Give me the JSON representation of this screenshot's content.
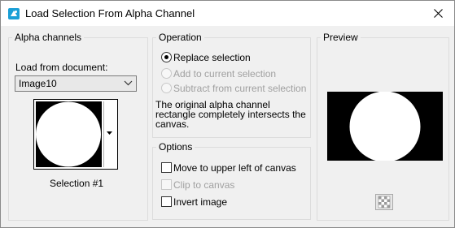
{
  "window": {
    "title": "Load Selection From Alpha Channel",
    "icon": "app-icon",
    "close_icon": "close-icon"
  },
  "alpha_channels": {
    "group_label": "Alpha channels",
    "load_from_label": "Load from document:",
    "document": {
      "selected": "Image10"
    },
    "selection_name": "Selection #1"
  },
  "operation": {
    "group_label": "Operation",
    "options": [
      {
        "label": "Replace selection",
        "checked": true,
        "enabled": true
      },
      {
        "label": "Add to current selection",
        "checked": false,
        "enabled": false
      },
      {
        "label": "Subtract from current selection",
        "checked": false,
        "enabled": false
      }
    ],
    "description": [
      "The original alpha channel",
      "rectangle completely intersects the",
      "canvas."
    ]
  },
  "options": {
    "group_label": "Options",
    "items": [
      {
        "label": "Move to upper left of canvas",
        "checked": false,
        "enabled": true
      },
      {
        "label": "Clip to canvas",
        "checked": false,
        "enabled": false
      },
      {
        "label": "Invert image",
        "checked": false,
        "enabled": true
      }
    ]
  },
  "preview": {
    "group_label": "Preview",
    "toggle_icon": "transparency-checker-icon"
  },
  "colors": {
    "window_bg": "#f0f0f0",
    "titlebar_bg": "#ffffff",
    "app_icon": "#1a9fd6"
  }
}
